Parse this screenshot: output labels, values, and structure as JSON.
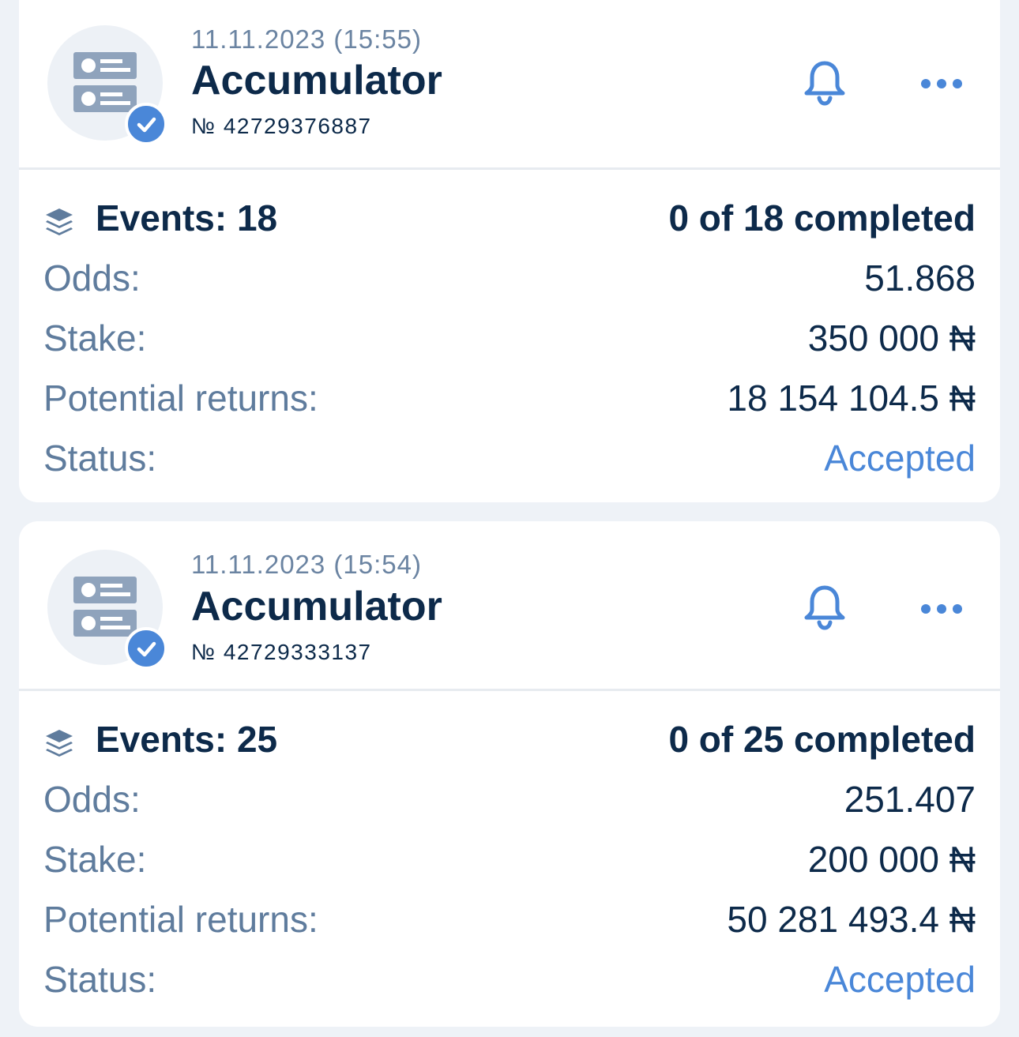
{
  "bets": [
    {
      "datetime": "11.11.2023 (15:55)",
      "type": "Accumulator",
      "number": "№ 42729376887",
      "events_label": "Events: 18",
      "completed": "0 of 18 completed",
      "odds_label": "Odds:",
      "odds": "51.868",
      "stake_label": "Stake:",
      "stake": "350 000 ₦",
      "returns_label": "Potential returns:",
      "returns": "18 154 104.5 ₦",
      "status_label": "Status:",
      "status": "Accepted"
    },
    {
      "datetime": "11.11.2023 (15:54)",
      "type": "Accumulator",
      "number": "№ 42729333137",
      "events_label": "Events: 25",
      "completed": "0 of 25 completed",
      "odds_label": "Odds:",
      "odds": "251.407",
      "stake_label": "Stake:",
      "stake": "200 000 ₦",
      "returns_label": "Potential returns:",
      "returns": "50 281 493.4 ₦",
      "status_label": "Status:",
      "status": "Accepted"
    }
  ],
  "icons": {
    "avatar": "ticket-icon",
    "badge": "check-icon",
    "notify": "bell-icon",
    "menu": "more-icon",
    "events": "layers-icon"
  },
  "colors": {
    "accent": "#4a87d8",
    "text_dark": "#0d2a4a",
    "text_muted": "#5f7c9d",
    "background": "#eef2f7",
    "card": "#ffffff"
  }
}
